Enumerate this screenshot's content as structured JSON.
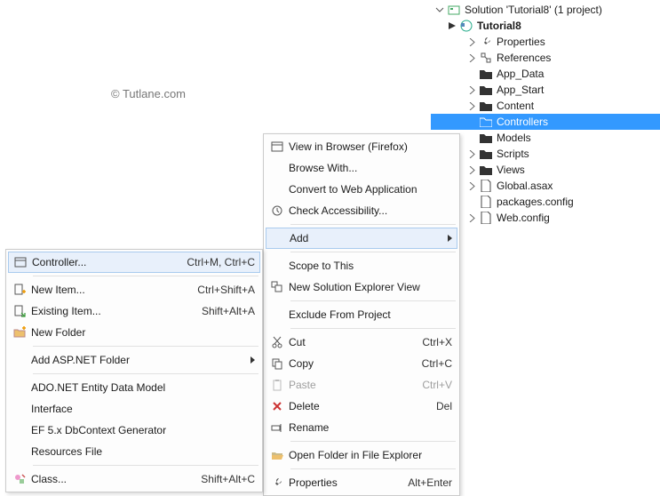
{
  "watermark": "© Tutlane.com",
  "solution": {
    "root": "Solution 'Tutorial8' (1 project)",
    "project": "Tutorial8",
    "items": [
      {
        "label": "Properties",
        "expandable": true
      },
      {
        "label": "References",
        "expandable": true
      },
      {
        "label": "App_Data",
        "expandable": false
      },
      {
        "label": "App_Start",
        "expandable": true
      },
      {
        "label": "Content",
        "expandable": true
      },
      {
        "label": "Controllers",
        "expandable": false,
        "selected": true
      },
      {
        "label": "Models",
        "expandable": false
      },
      {
        "label": "Scripts",
        "expandable": true
      },
      {
        "label": "Views",
        "expandable": true
      },
      {
        "label": "Global.asax",
        "expandable": true,
        "file": true
      },
      {
        "label": "packages.config",
        "expandable": false,
        "file": true
      },
      {
        "label": "Web.config",
        "expandable": true,
        "file": true
      }
    ]
  },
  "context_menu": [
    {
      "icon": "browser",
      "label": "View in Browser (Firefox)"
    },
    {
      "label": "Browse With..."
    },
    {
      "label": "Convert to Web Application"
    },
    {
      "icon": "clock",
      "label": "Check Accessibility..."
    },
    {
      "sep": true
    },
    {
      "label": "Add",
      "submenu": true,
      "highlight": true
    },
    {
      "sep": true
    },
    {
      "label": "Scope to This"
    },
    {
      "icon": "explorer",
      "label": "New Solution Explorer View"
    },
    {
      "sep": true
    },
    {
      "label": "Exclude From Project"
    },
    {
      "sep": true
    },
    {
      "icon": "cut",
      "label": "Cut",
      "shortcut": "Ctrl+X"
    },
    {
      "icon": "copy",
      "label": "Copy",
      "shortcut": "Ctrl+C"
    },
    {
      "icon": "paste",
      "label": "Paste",
      "shortcut": "Ctrl+V",
      "disabled": true
    },
    {
      "icon": "delete",
      "label": "Delete",
      "shortcut": "Del"
    },
    {
      "icon": "rename",
      "label": "Rename"
    },
    {
      "sep": true
    },
    {
      "icon": "folder-open",
      "label": "Open Folder in File Explorer"
    },
    {
      "sep": true
    },
    {
      "icon": "wrench",
      "label": "Properties",
      "shortcut": "Alt+Enter"
    }
  ],
  "add_submenu": [
    {
      "icon": "controller",
      "label": "Controller...",
      "shortcut": "Ctrl+M, Ctrl+C",
      "highlight": true
    },
    {
      "sep": true
    },
    {
      "icon": "new-item",
      "label": "New Item...",
      "shortcut": "Ctrl+Shift+A"
    },
    {
      "icon": "existing-item",
      "label": "Existing Item...",
      "shortcut": "Shift+Alt+A"
    },
    {
      "icon": "new-folder",
      "label": "New Folder"
    },
    {
      "sep": true
    },
    {
      "label": "Add ASP.NET Folder",
      "submenu": true
    },
    {
      "sep": true
    },
    {
      "label": "ADO.NET Entity Data Model"
    },
    {
      "label": "Interface"
    },
    {
      "label": "EF 5.x DbContext Generator"
    },
    {
      "label": "Resources File"
    },
    {
      "sep": true
    },
    {
      "icon": "class",
      "label": "Class...",
      "shortcut": "Shift+Alt+C"
    }
  ]
}
